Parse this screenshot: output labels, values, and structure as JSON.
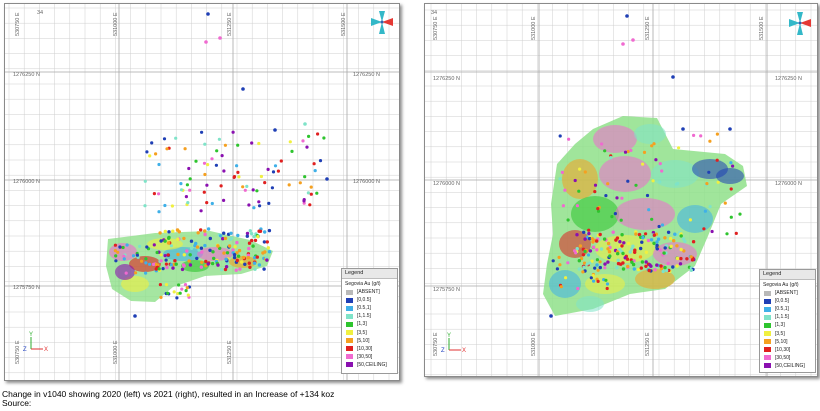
{
  "caption": {
    "line1": "Change in v1040 showing 2020 (left) vs 2021 (right), resulted in an Increase of +134 koz",
    "line2": "Source:"
  },
  "map": {
    "northing_labels": [
      "1276250 N",
      "1276000 N",
      "1275750 N"
    ],
    "easting_labels": [
      "530750 E",
      "531000 E",
      "531250 E",
      "531500 E"
    ],
    "corner_label": "34",
    "axis_y": "Y",
    "axis_z": "Z",
    "axis_x": "X"
  },
  "legend": {
    "title": "Legend",
    "subtitle": "Segovia Au (g/t)",
    "items": [
      {
        "label": "[ABSENT]",
        "color": "#b9b9b9"
      },
      {
        "label": "[0,0.5]",
        "color": "#1f3fb5"
      },
      {
        "label": "[0.5,1]",
        "color": "#3fb0e8"
      },
      {
        "label": "[1,1.5]",
        "color": "#7fe3c8"
      },
      {
        "label": "[1,3]",
        "color": "#2ec42e"
      },
      {
        "label": "[3,5]",
        "color": "#f0f040"
      },
      {
        "label": "[5,10]",
        "color": "#f5a020"
      },
      {
        "label": "[10,30]",
        "color": "#e02020"
      },
      {
        "label": "[30,50]",
        "color": "#f06ad0"
      },
      {
        "label": "[50,CEILING]",
        "color": "#8a10b0"
      }
    ]
  },
  "colors": {
    "grid": "#cfcfcf",
    "grid_major": "#a8a8a8",
    "compass_red": "#e53935",
    "compass_teal": "#33b8c8"
  }
}
